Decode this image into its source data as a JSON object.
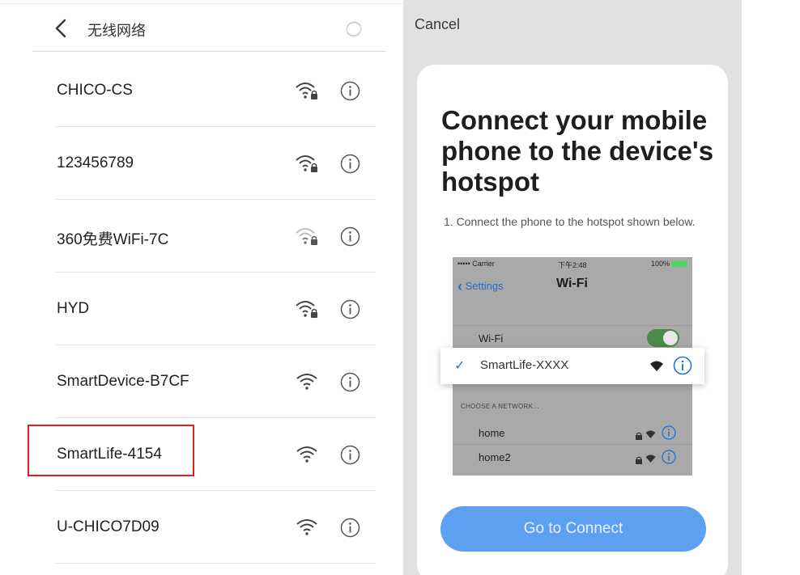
{
  "left_panel": {
    "title": "无线网络",
    "networks": [
      {
        "ssid": "CHICO-CS",
        "secured": true,
        "signal": "strong"
      },
      {
        "ssid": "123456789",
        "secured": true,
        "signal": "strong"
      },
      {
        "ssid": "360免费WiFi-7C",
        "secured": true,
        "signal": "weak"
      },
      {
        "ssid": "HYD",
        "secured": true,
        "signal": "strong"
      },
      {
        "ssid": "SmartDevice-B7CF",
        "secured": false,
        "signal": "strong"
      },
      {
        "ssid": "SmartLife-4154",
        "secured": false,
        "signal": "strong",
        "highlighted": true
      },
      {
        "ssid": "U-CHICO7D09",
        "secured": false,
        "signal": "strong"
      }
    ],
    "highlight_color": "#e01e1e"
  },
  "right_panel": {
    "cancel_label": "Cancel",
    "title": "Connect your mobile phone to the device's hotspot",
    "step_text": "1. Connect the phone to the hotspot shown below.",
    "ios_screenshot": {
      "carrier": "••••• Carrier",
      "time": "下午2:48",
      "battery": "100%",
      "back_label": "Settings",
      "title": "Wi-Fi",
      "wifi_label": "Wi-Fi",
      "wifi_enabled": true,
      "selected_network": "SmartLife-XXXX",
      "choose_label": "CHOOSE A NETWORK...",
      "networks": [
        "home",
        "home2"
      ]
    },
    "connect_button_label": "Go to Connect",
    "accent_color": "#5d9ff0"
  }
}
